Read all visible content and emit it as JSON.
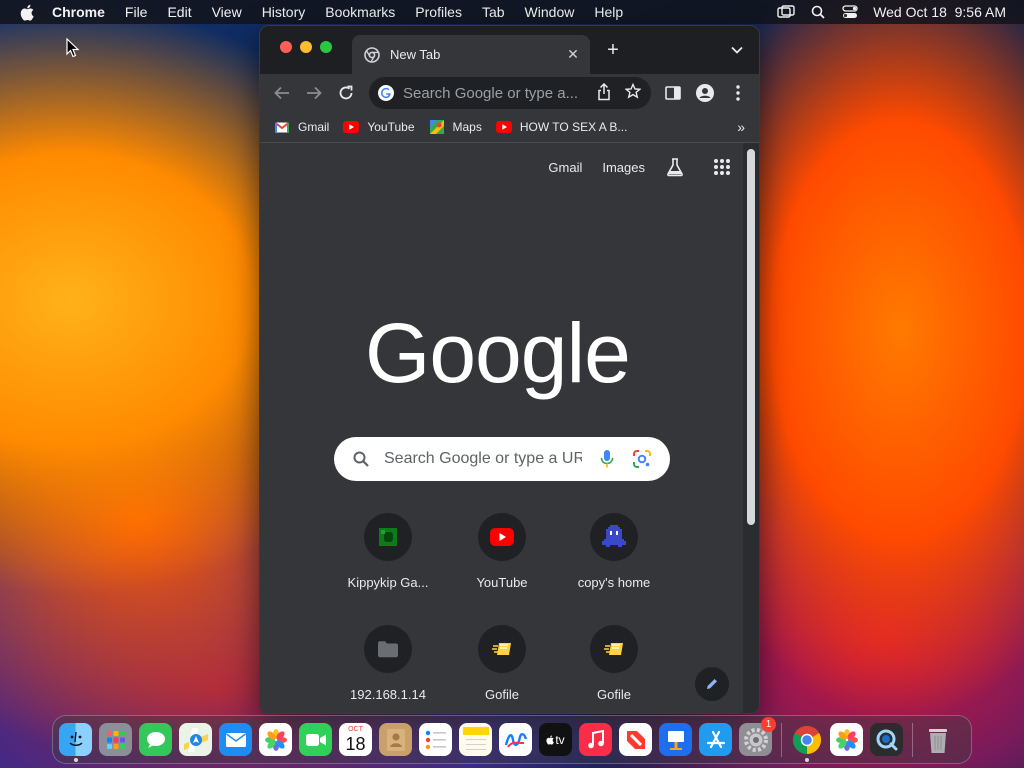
{
  "menubar": {
    "app_name": "Chrome",
    "items": [
      "File",
      "Edit",
      "View",
      "History",
      "Bookmarks",
      "Profiles",
      "Tab",
      "Window",
      "Help"
    ],
    "clock": "Wed Oct 18  9:56 AM"
  },
  "browser": {
    "tab_title": "New Tab",
    "omnibox_placeholder": "Search Google or type a...",
    "bookmarks": [
      {
        "label": "Gmail",
        "icon": "gmail-icon"
      },
      {
        "label": "YouTube",
        "icon": "youtube-icon"
      },
      {
        "label": "Maps",
        "icon": "maps-icon"
      },
      {
        "label": "HOW TO SEX A B...",
        "icon": "youtube-icon"
      }
    ],
    "more_bookmarks": "»"
  },
  "newtab": {
    "toplinks": {
      "gmail": "Gmail",
      "images": "Images"
    },
    "logo": "Google",
    "search_placeholder": "Search Google or type a URL",
    "shortcuts": [
      {
        "label": "Kippykip Ga...",
        "icon": "kippykip-icon"
      },
      {
        "label": "YouTube",
        "icon": "youtube-icon"
      },
      {
        "label": "copy's home",
        "icon": "pixel-creature-icon"
      },
      {
        "label": "192.168.1.14",
        "icon": "folder-icon"
      },
      {
        "label": "Gofile",
        "icon": "gofile-icon"
      },
      {
        "label": "Gofile",
        "icon": "gofile-icon"
      }
    ]
  },
  "dock": {
    "calendar_month": "OCT",
    "calendar_day": "18",
    "tv_label": "tv",
    "settings_badge": "1",
    "apps": [
      "Finder",
      "Launchpad",
      "Messages",
      "Maps",
      "Mail",
      "Photos",
      "FaceTime",
      "Calendar",
      "Contacts",
      "Reminders",
      "Notes",
      "Freeform",
      "TV",
      "Music",
      "News",
      "Keynote",
      "App Store",
      "System Settings",
      "Chrome",
      "Photos",
      "QuickTime Player",
      "Trash"
    ]
  },
  "colors": {
    "window_bg": "#202124",
    "toolbar_bg": "#35363a",
    "accent_red": "#ff0000"
  }
}
